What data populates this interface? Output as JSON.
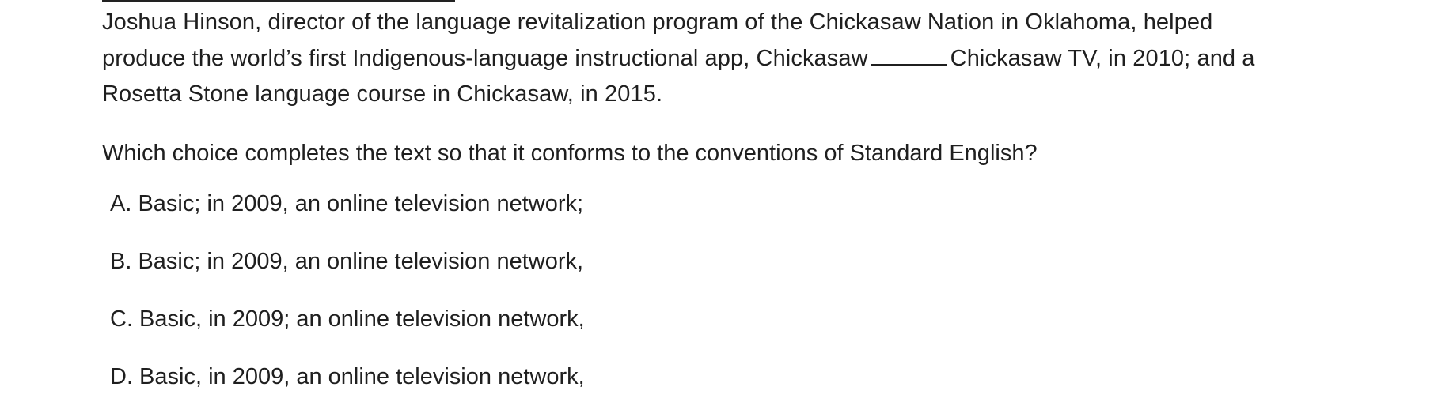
{
  "passage": {
    "line1": "Joshua Hinson, director of the language revitalization program of the Chickasaw Nation in Oklahoma, helped",
    "line2_before_blank": "produce the world’s first Indigenous-language instructional app, Chickasaw",
    "line2_after_blank": "Chickasaw TV, in 2010; and a",
    "line3": "Rosetta Stone language course in Chickasaw, in 2015."
  },
  "question": "Which choice completes the text so that it conforms to the conventions of Standard English?",
  "choices": [
    "A. Basic; in 2009, an online television network;",
    "B. Basic; in 2009, an online television network,",
    "C. Basic, in 2009; an online television network,",
    "D. Basic, in 2009, an online television network,"
  ]
}
